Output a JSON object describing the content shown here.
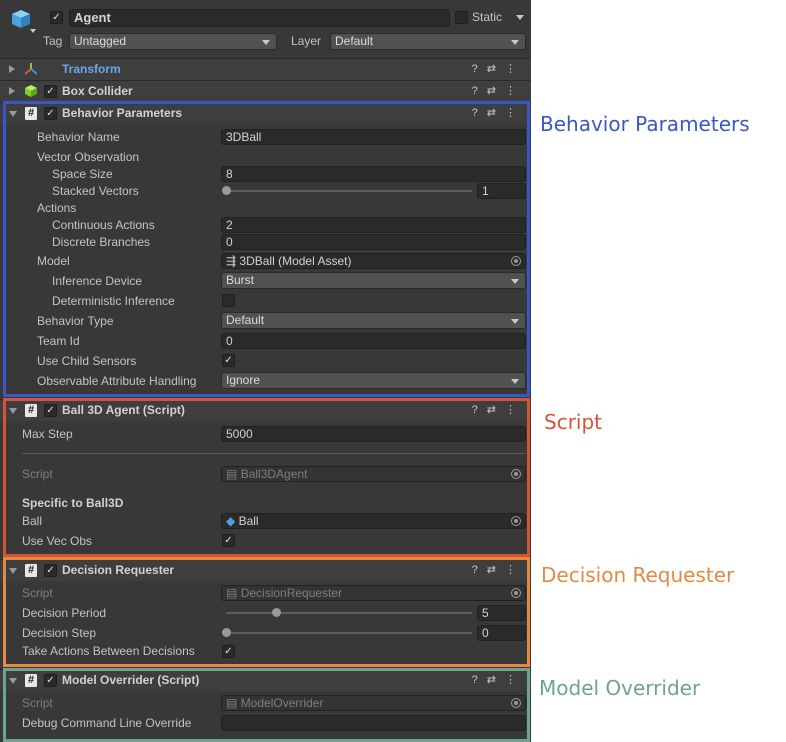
{
  "colors": {
    "behavior_parameters": "#3b57c4",
    "script": "#d2553a",
    "decision_requester": "#e38a42",
    "model_overrider": "#6fa38f"
  },
  "top": {
    "name_value": "Agent",
    "static_label": "Static",
    "tag_label": "Tag",
    "tag_value": "Untagged",
    "layer_label": "Layer",
    "layer_value": "Default"
  },
  "components": {
    "transform": {
      "title": "Transform"
    },
    "box_collider": {
      "title": "Box Collider"
    },
    "behavior_parameters": {
      "title": "Behavior Parameters",
      "behavior_name_label": "Behavior Name",
      "behavior_name_value": "3DBall",
      "vector_observation_label": "Vector Observation",
      "space_size_label": "Space Size",
      "space_size_value": "8",
      "stacked_vectors_label": "Stacked Vectors",
      "stacked_vectors_value": "1",
      "actions_label": "Actions",
      "continuous_actions_label": "Continuous Actions",
      "continuous_actions_value": "2",
      "discrete_branches_label": "Discrete Branches",
      "discrete_branches_value": "0",
      "model_label": "Model",
      "model_value": "3DBall (Model Asset)",
      "inference_device_label": "Inference Device",
      "inference_device_value": "Burst",
      "deterministic_inference_label": "Deterministic Inference",
      "behavior_type_label": "Behavior Type",
      "behavior_type_value": "Default",
      "team_id_label": "Team Id",
      "team_id_value": "0",
      "use_child_sensors_label": "Use Child Sensors",
      "observable_attr_label": "Observable Attribute Handling",
      "observable_attr_value": "Ignore"
    },
    "ball3d_agent": {
      "title": "Ball 3D Agent (Script)",
      "max_step_label": "Max Step",
      "max_step_value": "5000",
      "script_label": "Script",
      "script_value": "Ball3DAgent",
      "section_label": "Specific to Ball3D",
      "ball_label": "Ball",
      "ball_value": "Ball",
      "use_vec_obs_label": "Use Vec Obs"
    },
    "decision_requester": {
      "title": "Decision Requester",
      "script_label": "Script",
      "script_value": "DecisionRequester",
      "decision_period_label": "Decision Period",
      "decision_period_value": "5",
      "decision_step_label": "Decision Step",
      "decision_step_value": "0",
      "take_actions_label": "Take Actions Between Decisions"
    },
    "model_overrider": {
      "title": "Model Overrider (Script)",
      "script_label": "Script",
      "script_value": "ModelOverrider",
      "debug_cmd_label": "Debug Command Line Override",
      "debug_cmd_value": ""
    }
  },
  "annotations": {
    "behavior_parameters": "Behavior Parameters",
    "script": "Script",
    "decision_requester": "Decision Requester",
    "model_overrider": "Model Overrider"
  },
  "header_icons": {
    "help": "?",
    "presets": "⇄",
    "menu": "⋮"
  }
}
